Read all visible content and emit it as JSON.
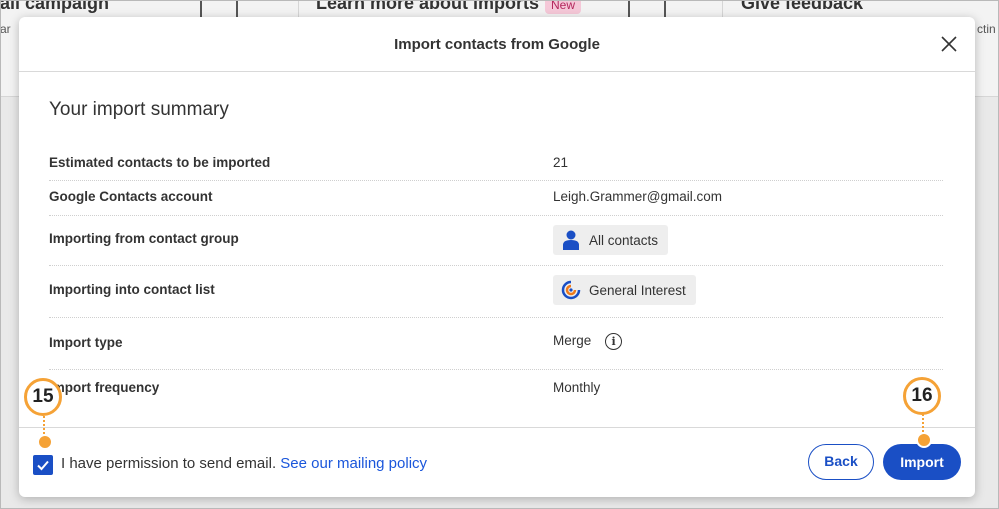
{
  "background": {
    "item1": "ail campaign",
    "item1_sub": "ar",
    "item2": "Learn more about imports",
    "item2_badge": "New",
    "item3": "Give feedback",
    "item3_sub": "ctin"
  },
  "modal": {
    "title": "Import contacts from Google",
    "section_title": "Your import summary",
    "rows": [
      {
        "label": "Estimated contacts to be imported",
        "value": "21"
      },
      {
        "label": "Google Contacts account",
        "value": "Leigh.Grammer@gmail.com"
      },
      {
        "label": "Importing from contact group",
        "value": "All contacts",
        "icon": "person-icon"
      },
      {
        "label": "Importing into contact list",
        "value": "General Interest",
        "icon": "list-logo-icon"
      },
      {
        "label": "Import type",
        "value": "Merge",
        "info": "i"
      },
      {
        "label": "Import frequency",
        "value": "Monthly"
      }
    ],
    "permission_text": "I have permission to send email.",
    "permission_link": "See our mailing policy",
    "permission_checked": true,
    "back_label": "Back",
    "import_label": "Import"
  },
  "callouts": {
    "checkbox_step": "15",
    "import_step": "16"
  },
  "colors": {
    "primary": "#1a4fc5",
    "link": "#1a56db",
    "callout": "#f5a236"
  }
}
